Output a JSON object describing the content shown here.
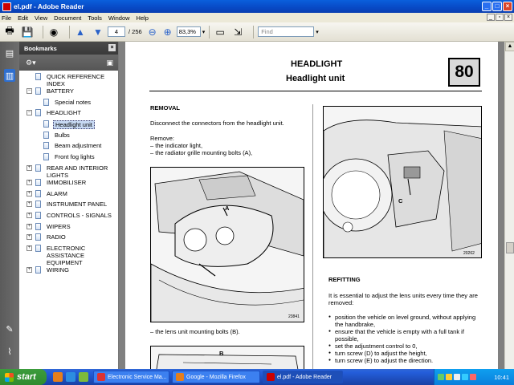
{
  "window": {
    "title": "el.pdf - Adobe Reader"
  },
  "menu": [
    "File",
    "Edit",
    "View",
    "Document",
    "Tools",
    "Window",
    "Help"
  ],
  "toolbar": {
    "page_current": "4",
    "page_total": "/ 256",
    "zoom": "83,3%",
    "find_placeholder": "Find"
  },
  "bookmarks": {
    "title": "Bookmarks",
    "items": [
      {
        "label": "QUICK REFERENCE INDEX",
        "level": 0,
        "expander": "",
        "selected": false
      },
      {
        "label": "BATTERY",
        "level": 0,
        "expander": "−",
        "selected": false
      },
      {
        "label": "Special notes",
        "level": 1,
        "expander": "",
        "selected": false
      },
      {
        "label": "HEADLIGHT",
        "level": 0,
        "expander": "−",
        "selected": false
      },
      {
        "label": "Headlight unit",
        "level": 1,
        "expander": "",
        "selected": true
      },
      {
        "label": "Bulbs",
        "level": 1,
        "expander": "",
        "selected": false
      },
      {
        "label": "Beam adjustment",
        "level": 1,
        "expander": "",
        "selected": false
      },
      {
        "label": "Front fog lights",
        "level": 1,
        "expander": "",
        "selected": false
      },
      {
        "label": "REAR AND INTERIOR LIGHTS",
        "level": 0,
        "expander": "+",
        "selected": false
      },
      {
        "label": "IMMOBILISER",
        "level": 0,
        "expander": "+",
        "selected": false
      },
      {
        "label": "ALARM",
        "level": 0,
        "expander": "+",
        "selected": false
      },
      {
        "label": "INSTRUMENT PANEL",
        "level": 0,
        "expander": "+",
        "selected": false
      },
      {
        "label": "CONTROLS - SIGNALS",
        "level": 0,
        "expander": "+",
        "selected": false
      },
      {
        "label": "WIPERS",
        "level": 0,
        "expander": "+",
        "selected": false
      },
      {
        "label": "RADIO",
        "level": 0,
        "expander": "+",
        "selected": false
      },
      {
        "label": "ELECTRONIC ASSISTANCE EQUIPMENT",
        "level": 0,
        "expander": "+",
        "selected": false
      },
      {
        "label": "WIRING",
        "level": 0,
        "expander": "+",
        "selected": false
      }
    ]
  },
  "page": {
    "heading1": "HEADLIGHT",
    "heading2": "Headlight unit",
    "section_number": "80",
    "removal": {
      "title": "REMOVAL",
      "intro": "Disconnect the connectors from the headlight unit.",
      "remove_label": "Remove:",
      "remove_items": [
        "–  the indicator light,",
        "–  the radiator grille mounting bolts (A),"
      ],
      "fig1_label": "A",
      "fig1_number": "23841",
      "after_fig": "–  the lens unit mounting bolts (B).",
      "fig3_label": "B"
    },
    "fig2_label": "C",
    "fig2_number": "20262",
    "refitting": {
      "title": "REFITTING",
      "intro": "It is essential to adjust the lens units every time they are removed:",
      "bullets": [
        "position the vehicle on level ground, without applying the handbrake,",
        "ensure that the vehicle is empty with a full tank if possible,",
        "set the adjustment control to 0,",
        "turn screw (D) to adjust the height,",
        "turn screw (E) to adjust the direction."
      ]
    }
  },
  "taskbar": {
    "start": "start",
    "tasks": [
      "Electronic Service Ma...",
      "Google - Mozilla Firefox",
      "el.pdf - Adobe Reader"
    ],
    "clock": "10:41"
  }
}
